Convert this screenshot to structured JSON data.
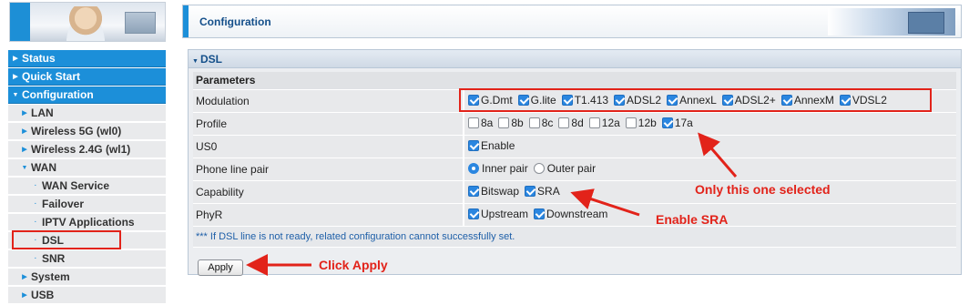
{
  "sidebar": {
    "items": [
      {
        "label": "Status",
        "level": 0,
        "expanded": false
      },
      {
        "label": "Quick Start",
        "level": 0,
        "expanded": false
      },
      {
        "label": "Configuration",
        "level": 0,
        "expanded": true
      },
      {
        "label": "LAN",
        "level": 1,
        "expanded": false
      },
      {
        "label": "Wireless 5G (wl0)",
        "level": 1,
        "expanded": false
      },
      {
        "label": "Wireless 2.4G (wl1)",
        "level": 1,
        "expanded": false
      },
      {
        "label": "WAN",
        "level": 1,
        "expanded": true
      },
      {
        "label": "WAN Service",
        "level": 2
      },
      {
        "label": "Failover",
        "level": 2
      },
      {
        "label": "IPTV Applications",
        "level": 2
      },
      {
        "label": "DSL",
        "level": 2,
        "highlighted": true
      },
      {
        "label": "SNR",
        "level": 2
      },
      {
        "label": "System",
        "level": 1,
        "expanded": false
      },
      {
        "label": "USB",
        "level": 1,
        "expanded": false
      }
    ]
  },
  "header": {
    "title": "Configuration"
  },
  "panel": {
    "title": "DSL",
    "params_header": "Parameters",
    "rows": {
      "modulation": {
        "label": "Modulation",
        "options": [
          {
            "label": "G.Dmt",
            "checked": true
          },
          {
            "label": "G.lite",
            "checked": true
          },
          {
            "label": "T1.413",
            "checked": true
          },
          {
            "label": "ADSL2",
            "checked": true
          },
          {
            "label": "AnnexL",
            "checked": true
          },
          {
            "label": "ADSL2+",
            "checked": true
          },
          {
            "label": "AnnexM",
            "checked": true
          },
          {
            "label": "VDSL2",
            "checked": true
          }
        ]
      },
      "profile": {
        "label": "Profile",
        "options": [
          {
            "label": "8a",
            "checked": false
          },
          {
            "label": "8b",
            "checked": false
          },
          {
            "label": "8c",
            "checked": false
          },
          {
            "label": "8d",
            "checked": false
          },
          {
            "label": "12a",
            "checked": false
          },
          {
            "label": "12b",
            "checked": false
          },
          {
            "label": "17a",
            "checked": true
          }
        ]
      },
      "us0": {
        "label": "US0",
        "options": [
          {
            "label": "Enable",
            "checked": true
          }
        ]
      },
      "phone_line_pair": {
        "label": "Phone line pair",
        "options": [
          {
            "label": "Inner pair",
            "selected": true
          },
          {
            "label": "Outer pair",
            "selected": false
          }
        ]
      },
      "capability": {
        "label": "Capability",
        "options": [
          {
            "label": "Bitswap",
            "checked": true
          },
          {
            "label": "SRA",
            "checked": true
          }
        ]
      },
      "phyr": {
        "label": "PhyR",
        "options": [
          {
            "label": "Upstream",
            "checked": true
          },
          {
            "label": "Downstream",
            "checked": true
          }
        ]
      }
    },
    "note": "*** If DSL line is not ready, related configuration cannot successfully set.",
    "apply_label": "Apply"
  },
  "annotations": {
    "profile": "Only this one selected",
    "sra": "Enable SRA",
    "apply": "Click Apply",
    "color": "#e2231a"
  },
  "colors": {
    "accent_blue": "#1c8fd9",
    "checkbox_blue": "#2a86e0",
    "title_blue": "#144f8a"
  }
}
